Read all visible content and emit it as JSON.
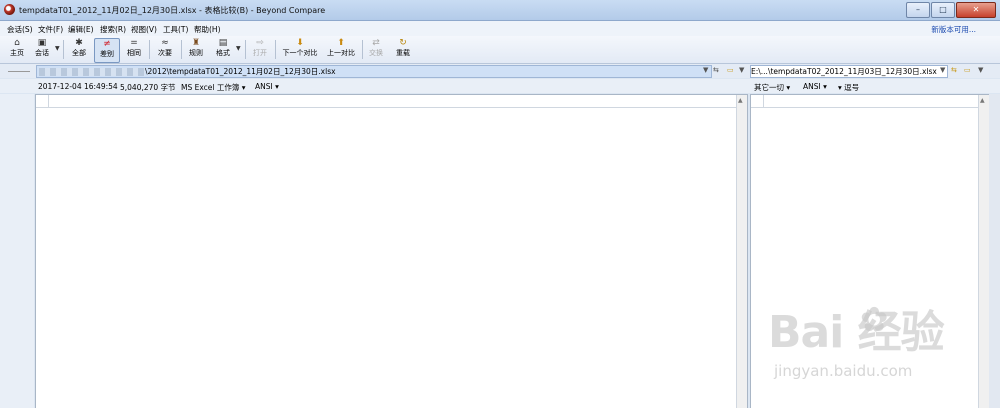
{
  "window": {
    "title": "tempdataT01_2012_11月02日_12月30日.xlsx - 表格比较(B) - Beyond Compare",
    "buttons": {
      "minimize": "–",
      "maximize": "□",
      "close": "✕"
    }
  },
  "menu": {
    "items": [
      "会话(S)",
      "文件(F)",
      "编辑(E)",
      "搜索(R)",
      "视图(V)",
      "工具(T)",
      "帮助(H)"
    ],
    "help_link": "新版本可用..."
  },
  "toolbar": {
    "home": "主页",
    "session": "会话",
    "all": "全部",
    "diff": "差别",
    "same": "相同",
    "minor": "次要",
    "rules": "规则",
    "format": "格式",
    "open": "打开",
    "next_diff": "下一个对比",
    "prev_diff": "上一对比",
    "swap": "交换",
    "reload": "重载"
  },
  "left": {
    "path": "\\2012\\tempdataT01_2012_11月02日_12月30日.xlsx",
    "info": {
      "timestamp": "2017-12-04 16:49:54",
      "size": "5,040,270 字节",
      "format": "MS Excel 工作簿",
      "encoding": "ANSI"
    }
  },
  "right": {
    "path": "E:\\...\\tempdataT02_2012_11月03日_12月30日.xlsx",
    "info": {
      "other": "其它一切",
      "encoding": "ANSI",
      "delimiter": "逗号"
    }
  },
  "watermark": {
    "brand": "Bai  经验",
    "url": "jingyan.baidu.com"
  }
}
